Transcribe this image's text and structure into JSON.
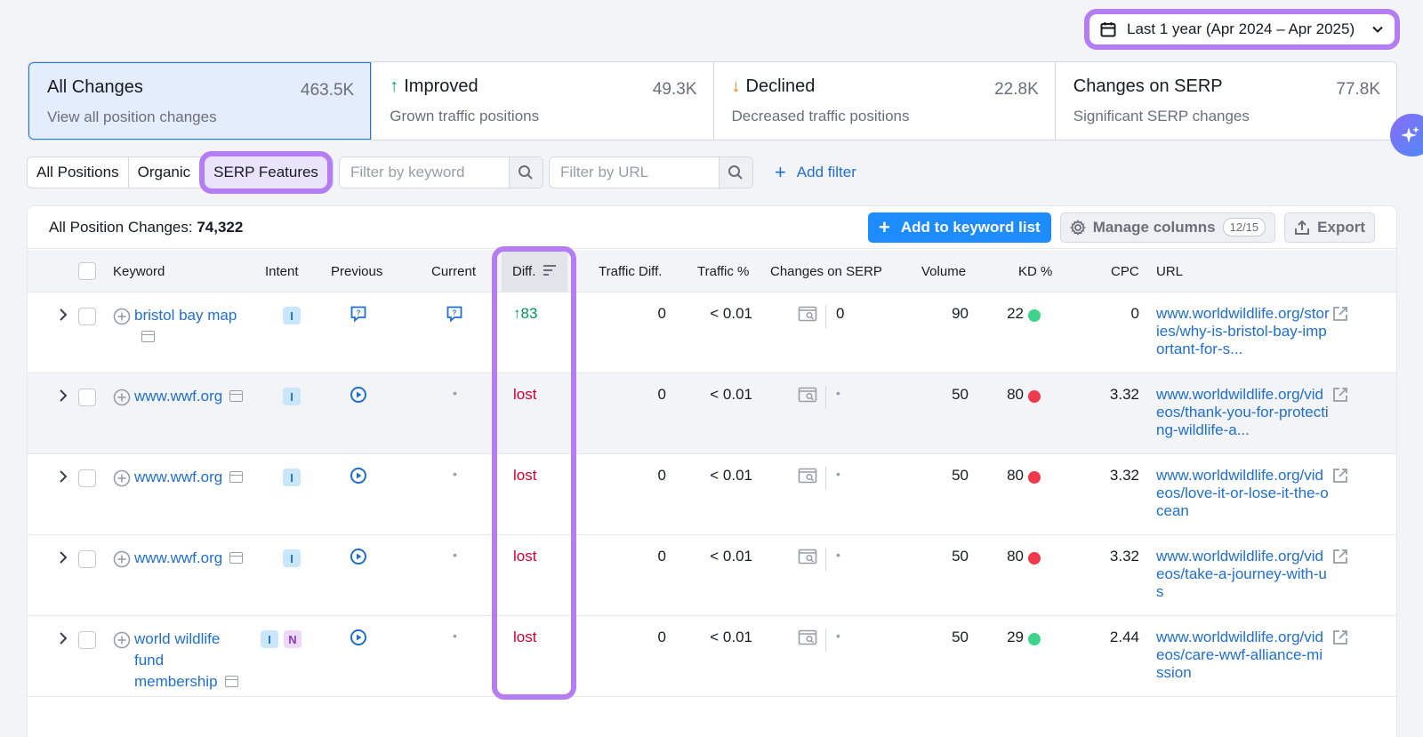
{
  "date_range": {
    "label": "Last 1 year (Apr 2024 – Apr 2025)"
  },
  "cards": [
    {
      "title": "All Changes",
      "value": "463.5K",
      "subtitle": "View all position changes",
      "arrow": ""
    },
    {
      "title": "Improved",
      "value": "49.3K",
      "subtitle": "Grown traffic positions",
      "arrow": "↑"
    },
    {
      "title": "Declined",
      "value": "22.8K",
      "subtitle": "Decreased traffic positions",
      "arrow": "↓"
    },
    {
      "title": "Changes on SERP",
      "value": "77.8K",
      "subtitle": "Significant SERP changes",
      "arrow": ""
    }
  ],
  "filters": {
    "tabs": [
      "All Positions",
      "Organic",
      "SERP Features"
    ],
    "keyword_placeholder": "Filter by keyword",
    "url_placeholder": "Filter by URL",
    "add_filter": "Add filter"
  },
  "panel": {
    "title_prefix": "All Position Changes:",
    "total": "74,322",
    "add_keyword_list": "Add to keyword list",
    "manage_columns": "Manage columns",
    "columns_count": "12/15",
    "export": "Export"
  },
  "columns": {
    "keyword": "Keyword",
    "intent": "Intent",
    "previous": "Previous",
    "current": "Current",
    "diff": "Diff.",
    "traffic_diff": "Traffic Diff.",
    "traffic_pct": "Traffic %",
    "changes_on_serp": "Changes on SERP",
    "volume": "Volume",
    "kd": "KD %",
    "cpc": "CPC",
    "url": "URL"
  },
  "rows": [
    {
      "keyword": "bristol bay map",
      "intent": [
        "I"
      ],
      "diff": "↑83",
      "traffic_diff": "0",
      "traffic_pct": "< 0.01",
      "serp": "0",
      "volume": "90",
      "kd": "22",
      "kd_color": "#3fd28b",
      "cpc": "0",
      "url": "www.worldwildlife.org/stories/why-is-bristol-bay-important-for-s..."
    },
    {
      "keyword": "www.wwf.org",
      "intent": [
        "I"
      ],
      "diff": "lost",
      "traffic_diff": "0",
      "traffic_pct": "< 0.01",
      "serp": "•",
      "volume": "50",
      "kd": "80",
      "kd_color": "#ee3a4b",
      "cpc": "3.32",
      "url": "www.worldwildlife.org/videos/thank-you-for-protecting-wildlife-a..."
    },
    {
      "keyword": "www.wwf.org",
      "intent": [
        "I"
      ],
      "diff": "lost",
      "traffic_diff": "0",
      "traffic_pct": "< 0.01",
      "serp": "•",
      "volume": "50",
      "kd": "80",
      "kd_color": "#ee3a4b",
      "cpc": "3.32",
      "url": "www.worldwildlife.org/videos/love-it-or-lose-it-the-ocean"
    },
    {
      "keyword": "www.wwf.org",
      "intent": [
        "I"
      ],
      "diff": "lost",
      "traffic_diff": "0",
      "traffic_pct": "< 0.01",
      "serp": "•",
      "volume": "50",
      "kd": "80",
      "kd_color": "#ee3a4b",
      "cpc": "3.32",
      "url": "www.worldwildlife.org/videos/take-a-journey-with-us"
    },
    {
      "keyword": "world wildlife fund membership",
      "intent": [
        "I",
        "N"
      ],
      "diff": "lost",
      "traffic_diff": "0",
      "traffic_pct": "< 0.01",
      "serp": "•",
      "volume": "50",
      "kd": "29",
      "kd_color": "#3fd28b",
      "cpc": "2.44",
      "url": "www.worldwildlife.org/videos/care-wwf-alliance-mission"
    }
  ]
}
